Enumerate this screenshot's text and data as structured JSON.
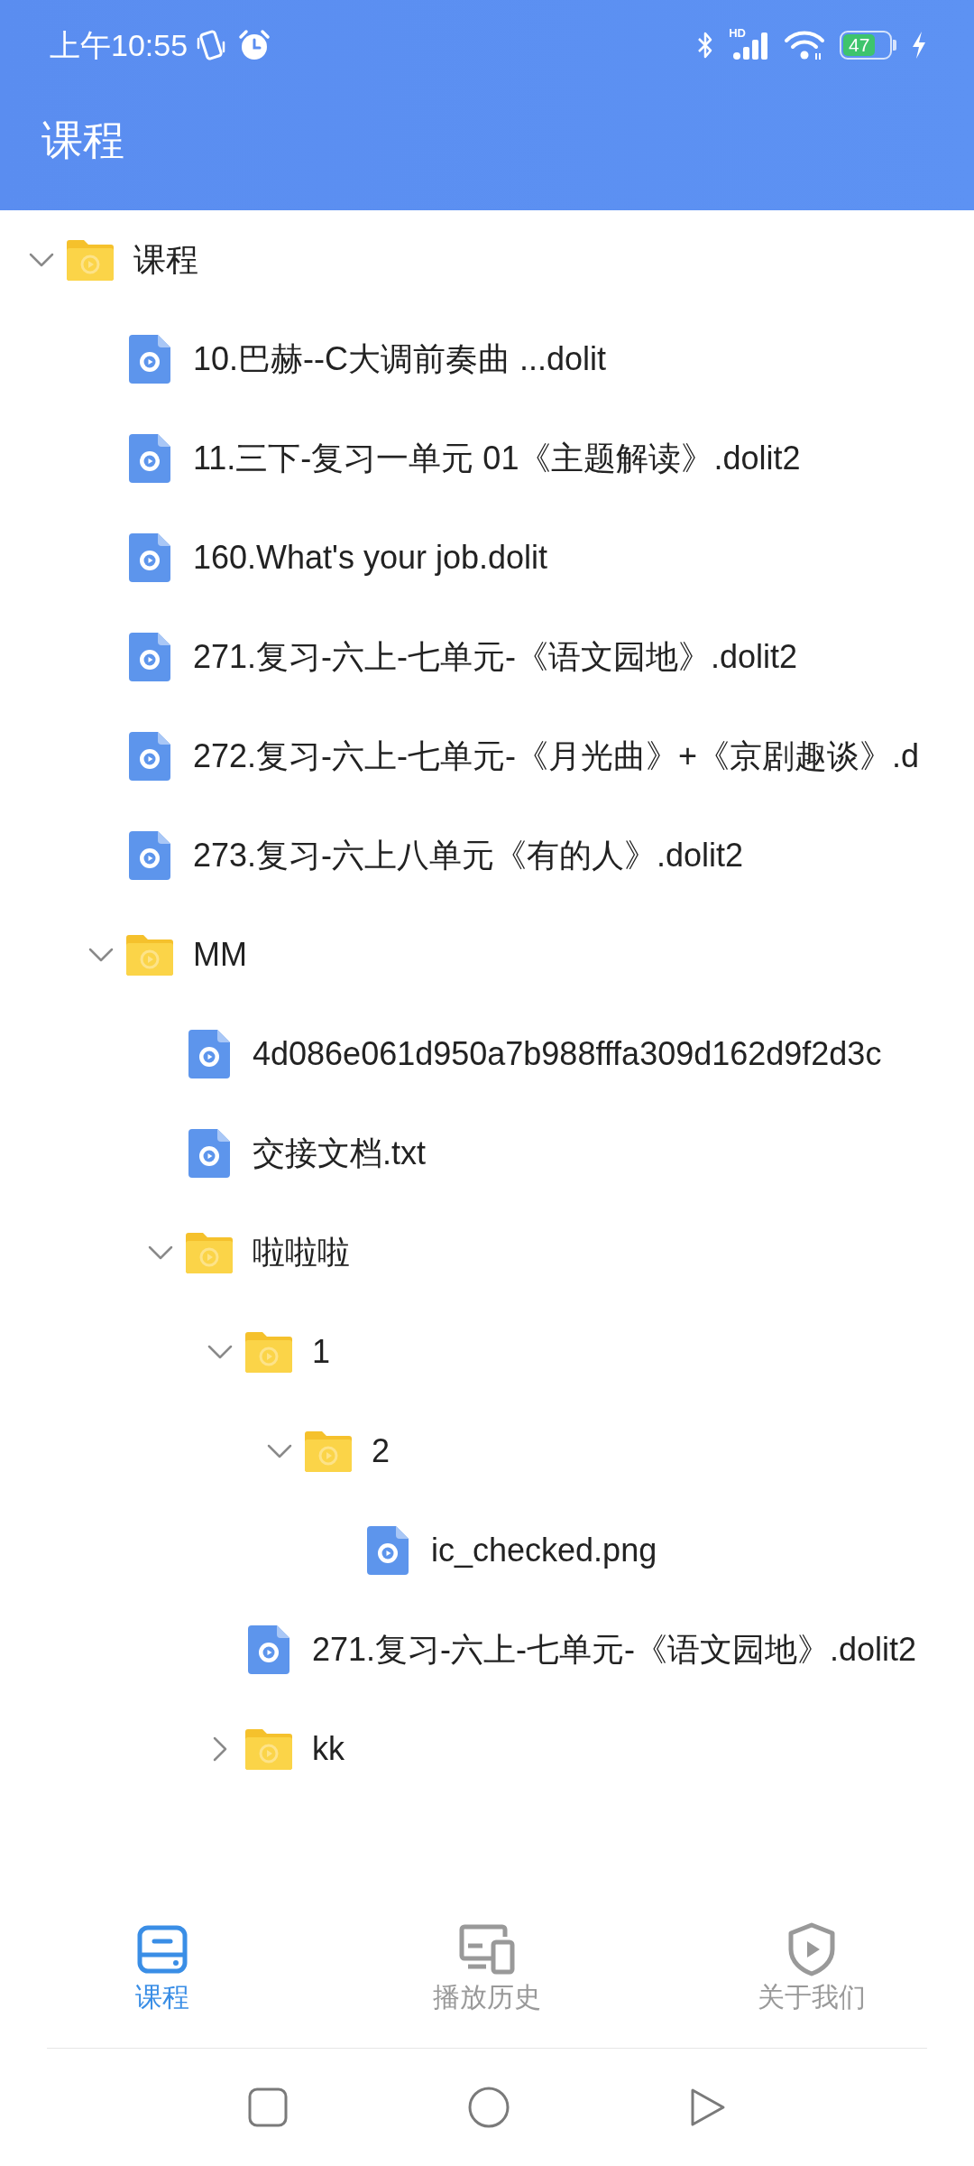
{
  "status_bar": {
    "time": "上午10:55",
    "network_type": "HD",
    "battery": "47"
  },
  "app_bar": {
    "title": "课程"
  },
  "tree": [
    {
      "kind": "folder",
      "name": "课程",
      "expanded": true,
      "children": [
        {
          "kind": "file",
          "name": "10.巴赫--C大调前奏曲 ...dolit"
        },
        {
          "kind": "file",
          "name": "11.三下-复习一单元 01《主题解读》.dolit2"
        },
        {
          "kind": "file",
          "name": "160.What's your job.dolit"
        },
        {
          "kind": "file",
          "name": "271.复习-六上-七单元-《语文园地》.dolit2"
        },
        {
          "kind": "file",
          "name": "272.复习-六上-七单元-《月光曲》+《京剧趣谈》.d"
        },
        {
          "kind": "file",
          "name": "273.复习-六上八单元《有的人》.dolit2"
        },
        {
          "kind": "folder",
          "name": "MM",
          "expanded": true,
          "children": [
            {
              "kind": "file",
              "name": "4d086e061d950a7b988fffa309d162d9f2d3c"
            },
            {
              "kind": "file",
              "name": "交接文档.txt"
            },
            {
              "kind": "folder",
              "name": "啦啦啦",
              "expanded": true,
              "children": [
                {
                  "kind": "folder",
                  "name": "1",
                  "expanded": true,
                  "children": [
                    {
                      "kind": "folder",
                      "name": "2",
                      "expanded": true,
                      "children": [
                        {
                          "kind": "file",
                          "name": "ic_checked.png"
                        }
                      ]
                    }
                  ]
                },
                {
                  "kind": "file",
                  "name": "271.复习-六上-七单元-《语文园地》.dolit2"
                },
                {
                  "kind": "folder",
                  "name": "kk",
                  "expanded": false
                }
              ]
            }
          ]
        }
      ]
    }
  ],
  "bottom_nav": {
    "tabs": [
      {
        "label": "课程",
        "selected": true
      },
      {
        "label": "播放历史",
        "selected": false
      },
      {
        "label": "关于我们",
        "selected": false
      }
    ]
  }
}
